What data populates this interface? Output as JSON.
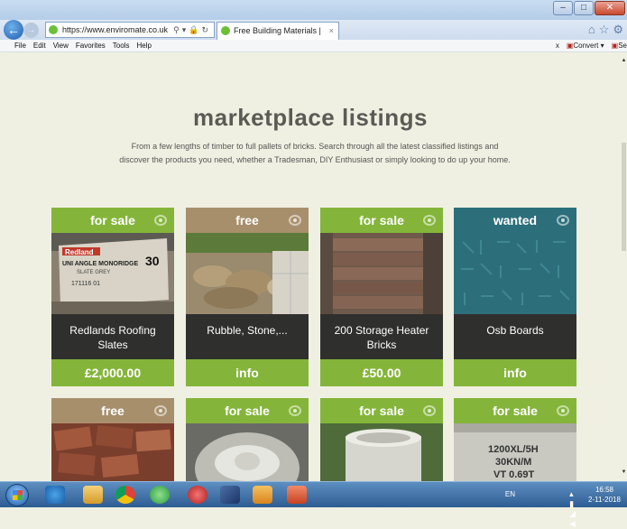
{
  "browser": {
    "url": "https://www.enviromate.co.uk",
    "tab_title": "Free Building Materials | En...",
    "tab_close": "×",
    "menu": [
      "File",
      "Edit",
      "View",
      "Favorites",
      "Tools",
      "Help"
    ],
    "menu_right": {
      "close": "x",
      "convert": "Convert",
      "select": "Se"
    }
  },
  "page": {
    "heading": "marketplace listings",
    "subtext": "From a few lengths of timber to full pallets of bricks. Search through all the latest classified listings and discover the products you need, whether a Tradesman, DIY Enthusiast or simply looking to do up your home."
  },
  "listings": [
    {
      "badge": "for sale",
      "title": "Redlands Roofing Slates",
      "price": "£2,000.00",
      "head_color": "#84b53a"
    },
    {
      "badge": "free",
      "title": "Rubble, Stone,...",
      "price": "info",
      "head_color": "#a88f6c"
    },
    {
      "badge": "for sale",
      "title": "200 Storage Heater Bricks",
      "price": "£50.00",
      "head_color": "#84b53a"
    },
    {
      "badge": "wanted",
      "title": "Osb Boards",
      "price": "info",
      "head_color": "#2c6f7a"
    },
    {
      "badge": "free",
      "head_color": "#a88f6c"
    },
    {
      "badge": "for sale",
      "head_color": "#84b53a"
    },
    {
      "badge": "for sale",
      "head_color": "#84b53a"
    },
    {
      "badge": "for sale",
      "head_color": "#84b53a"
    }
  ],
  "image_text": {
    "slates": {
      "brand": "Redland",
      "line1": "UNI ANGLE MONORIDGE",
      "line2": "SLATE GREY",
      "number": "30",
      "code": "171116 01"
    },
    "block": {
      "line1": "1200XL/5H",
      "line2": "30KN/M",
      "line3": "VT 0.69T"
    }
  },
  "taskbar": {
    "lang": "EN",
    "time": "16:58",
    "date": "2-11-2018"
  }
}
